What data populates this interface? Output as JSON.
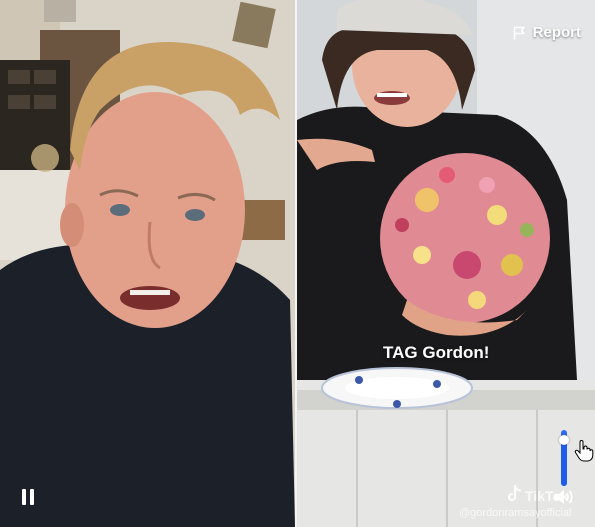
{
  "video": {
    "report_label": "Report",
    "caption": "TAG Gordon!",
    "watermark_brand": "TikTok",
    "watermark_handle": "@gordonramsayofficial",
    "volume_level": 0.82
  },
  "controls": {
    "pause_icon": "pause-icon",
    "volume_icon": "speaker-icon",
    "report_icon": "flag-icon"
  },
  "colors": {
    "accent": "#2f6df0",
    "text": "#ffffff"
  }
}
